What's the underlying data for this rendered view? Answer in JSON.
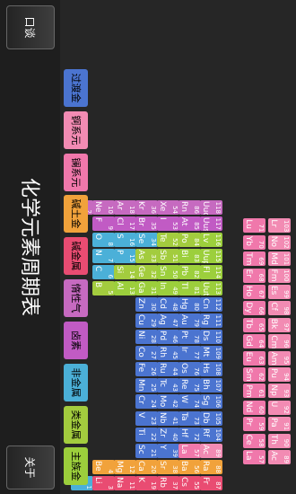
{
  "title": "化学元素周期表",
  "buttons": {
    "about": "关于",
    "back": "口谈"
  },
  "legend": [
    {
      "label": "主族金属",
      "color": "#9ccf3c"
    },
    {
      "label": "类金属",
      "color": "#a3cc3e"
    },
    {
      "label": "非金属",
      "color": "#4bb0d8"
    },
    {
      "label": "卤素",
      "color": "#c15bc4"
    },
    {
      "label": "惰性气体",
      "color": "#c66ac0"
    },
    {
      "label": "碱金属",
      "color": "#e94c72"
    },
    {
      "label": "碱土金属",
      "color": "#f1a23b"
    },
    {
      "label": "镧系元素",
      "color": "#f078ab"
    },
    {
      "label": "锕系元素",
      "color": "#f28bb3"
    },
    {
      "label": "过渡金属",
      "color": "#4b74d0"
    }
  ],
  "elements": [
    {
      "n": "1",
      "s": "H",
      "c": "#4bb0d8"
    },
    {
      "n": "2",
      "s": "He",
      "c": "#c66ac0"
    },
    {
      "n": "3",
      "s": "Li",
      "c": "#e94c72"
    },
    {
      "n": "4",
      "s": "Be",
      "c": "#f1a23b"
    },
    {
      "n": "5",
      "s": "B",
      "c": "#a3cc3e"
    },
    {
      "n": "6",
      "s": "C",
      "c": "#4bb0d8"
    },
    {
      "n": "7",
      "s": "N",
      "c": "#4bb0d8"
    },
    {
      "n": "8",
      "s": "O",
      "c": "#4bb0d8"
    },
    {
      "n": "9",
      "s": "F",
      "c": "#c15bc4"
    },
    {
      "n": "10",
      "s": "Ne",
      "c": "#c66ac0"
    },
    {
      "n": "11",
      "s": "Na",
      "c": "#e94c72"
    },
    {
      "n": "12",
      "s": "Mg",
      "c": "#f1a23b"
    },
    {
      "n": "13",
      "s": "Al",
      "c": "#9ccf3c"
    },
    {
      "n": "14",
      "s": "Si",
      "c": "#a3cc3e"
    },
    {
      "n": "15",
      "s": "P",
      "c": "#4bb0d8"
    },
    {
      "n": "16",
      "s": "S",
      "c": "#4bb0d8"
    },
    {
      "n": "17",
      "s": "Cl",
      "c": "#c15bc4"
    },
    {
      "n": "18",
      "s": "Ar",
      "c": "#c66ac0"
    },
    {
      "n": "19",
      "s": "K",
      "c": "#e94c72"
    },
    {
      "n": "20",
      "s": "Ca",
      "c": "#f1a23b"
    },
    {
      "n": "21",
      "s": "Sc",
      "c": "#4b74d0"
    },
    {
      "n": "22",
      "s": "Ti",
      "c": "#4b74d0"
    },
    {
      "n": "23",
      "s": "V",
      "c": "#4b74d0"
    },
    {
      "n": "24",
      "s": "Cr",
      "c": "#4b74d0"
    },
    {
      "n": "25",
      "s": "Mn",
      "c": "#4b74d0"
    },
    {
      "n": "26",
      "s": "Fe",
      "c": "#4b74d0"
    },
    {
      "n": "27",
      "s": "Co",
      "c": "#4b74d0"
    },
    {
      "n": "28",
      "s": "Ni",
      "c": "#4b74d0"
    },
    {
      "n": "29",
      "s": "Cu",
      "c": "#4b74d0"
    },
    {
      "n": "30",
      "s": "Zn",
      "c": "#4b74d0"
    },
    {
      "n": "31",
      "s": "Ga",
      "c": "#9ccf3c"
    },
    {
      "n": "32",
      "s": "Ge",
      "c": "#a3cc3e"
    },
    {
      "n": "33",
      "s": "As",
      "c": "#a3cc3e"
    },
    {
      "n": "34",
      "s": "Se",
      "c": "#4bb0d8"
    },
    {
      "n": "35",
      "s": "Br",
      "c": "#c15bc4"
    },
    {
      "n": "36",
      "s": "Kr",
      "c": "#c66ac0"
    },
    {
      "n": "37",
      "s": "Rb",
      "c": "#e94c72"
    },
    {
      "n": "38",
      "s": "Sr",
      "c": "#f1a23b"
    },
    {
      "n": "39",
      "s": "Y",
      "c": "#4b74d0"
    },
    {
      "n": "40",
      "s": "Zr",
      "c": "#4b74d0"
    },
    {
      "n": "41",
      "s": "Nb",
      "c": "#4b74d0"
    },
    {
      "n": "42",
      "s": "Mo",
      "c": "#4b74d0"
    },
    {
      "n": "43",
      "s": "Tc",
      "c": "#4b74d0"
    },
    {
      "n": "44",
      "s": "Ru",
      "c": "#4b74d0"
    },
    {
      "n": "45",
      "s": "Rh",
      "c": "#4b74d0"
    },
    {
      "n": "46",
      "s": "Pd",
      "c": "#4b74d0"
    },
    {
      "n": "47",
      "s": "Ag",
      "c": "#4b74d0"
    },
    {
      "n": "48",
      "s": "Cd",
      "c": "#4b74d0"
    },
    {
      "n": "49",
      "s": "In",
      "c": "#9ccf3c"
    },
    {
      "n": "50",
      "s": "Sn",
      "c": "#9ccf3c"
    },
    {
      "n": "51",
      "s": "Sb",
      "c": "#a3cc3e"
    },
    {
      "n": "52",
      "s": "Te",
      "c": "#a3cc3e"
    },
    {
      "n": "53",
      "s": "I",
      "c": "#c15bc4"
    },
    {
      "n": "54",
      "s": "Xe",
      "c": "#c66ac0"
    },
    {
      "n": "55",
      "s": "Cs",
      "c": "#e94c72"
    },
    {
      "n": "56",
      "s": "Ba",
      "c": "#f1a23b"
    },
    {
      "n": "57",
      "s": "La",
      "c": "#f078ab"
    },
    {
      "n": "72",
      "s": "Hf",
      "c": "#4b74d0"
    },
    {
      "n": "73",
      "s": "Ta",
      "c": "#4b74d0"
    },
    {
      "n": "74",
      "s": "W",
      "c": "#4b74d0"
    },
    {
      "n": "75",
      "s": "Re",
      "c": "#4b74d0"
    },
    {
      "n": "76",
      "s": "Os",
      "c": "#4b74d0"
    },
    {
      "n": "77",
      "s": "Ir",
      "c": "#4b74d0"
    },
    {
      "n": "78",
      "s": "Pt",
      "c": "#4b74d0"
    },
    {
      "n": "79",
      "s": "Au",
      "c": "#4b74d0"
    },
    {
      "n": "80",
      "s": "Hg",
      "c": "#4b74d0"
    },
    {
      "n": "81",
      "s": "Tl",
      "c": "#9ccf3c"
    },
    {
      "n": "82",
      "s": "Pb",
      "c": "#9ccf3c"
    },
    {
      "n": "83",
      "s": "Bi",
      "c": "#9ccf3c"
    },
    {
      "n": "84",
      "s": "Po",
      "c": "#a3cc3e"
    },
    {
      "n": "85",
      "s": "At",
      "c": "#c15bc4"
    },
    {
      "n": "86",
      "s": "Rn",
      "c": "#c66ac0"
    },
    {
      "n": "87",
      "s": "Fr",
      "c": "#e94c72"
    },
    {
      "n": "88",
      "s": "Ra",
      "c": "#f1a23b"
    },
    {
      "n": "89",
      "s": "Ac",
      "c": "#f28bb3"
    },
    {
      "n": "104",
      "s": "Rf",
      "c": "#4b74d0"
    },
    {
      "n": "105",
      "s": "Db",
      "c": "#4b74d0"
    },
    {
      "n": "106",
      "s": "Sg",
      "c": "#4b74d0"
    },
    {
      "n": "107",
      "s": "Bh",
      "c": "#4b74d0"
    },
    {
      "n": "108",
      "s": "Hs",
      "c": "#4b74d0"
    },
    {
      "n": "109",
      "s": "Mt",
      "c": "#4b74d0"
    },
    {
      "n": "110",
      "s": "Ds",
      "c": "#4b74d0"
    },
    {
      "n": "111",
      "s": "Rg",
      "c": "#4b74d0"
    },
    {
      "n": "112",
      "s": "Cn",
      "c": "#4b74d0"
    },
    {
      "n": "113",
      "s": "Uut",
      "c": "#9ccf3c"
    },
    {
      "n": "114",
      "s": "Fl",
      "c": "#9ccf3c"
    },
    {
      "n": "115",
      "s": "Uup",
      "c": "#9ccf3c"
    },
    {
      "n": "116",
      "s": "Lv",
      "c": "#9ccf3c"
    },
    {
      "n": "117",
      "s": "Uus",
      "c": "#c15bc4"
    },
    {
      "n": "118",
      "s": "Uuo",
      "c": "#c66ac0"
    },
    {
      "n": "57",
      "s": "La",
      "c": "#f078ab"
    },
    {
      "n": "58",
      "s": "Ce",
      "c": "#f078ab"
    },
    {
      "n": "59",
      "s": "Pr",
      "c": "#f078ab"
    },
    {
      "n": "60",
      "s": "Nd",
      "c": "#f078ab"
    },
    {
      "n": "61",
      "s": "Pm",
      "c": "#f078ab"
    },
    {
      "n": "62",
      "s": "Sm",
      "c": "#f078ab"
    },
    {
      "n": "63",
      "s": "Eu",
      "c": "#f078ab"
    },
    {
      "n": "64",
      "s": "Gd",
      "c": "#f078ab"
    },
    {
      "n": "65",
      "s": "Tb",
      "c": "#f078ab"
    },
    {
      "n": "66",
      "s": "Dy",
      "c": "#f078ab"
    },
    {
      "n": "67",
      "s": "Ho",
      "c": "#f078ab"
    },
    {
      "n": "68",
      "s": "Er",
      "c": "#f078ab"
    },
    {
      "n": "69",
      "s": "Tm",
      "c": "#f078ab"
    },
    {
      "n": "70",
      "s": "Yb",
      "c": "#f078ab"
    },
    {
      "n": "71",
      "s": "Lu",
      "c": "#f078ab"
    },
    {
      "n": "89",
      "s": "Ac",
      "c": "#f28bb3"
    },
    {
      "n": "90",
      "s": "Th",
      "c": "#f28bb3"
    },
    {
      "n": "91",
      "s": "Pa",
      "c": "#f28bb3"
    },
    {
      "n": "92",
      "s": "U",
      "c": "#f28bb3"
    },
    {
      "n": "93",
      "s": "Np",
      "c": "#f28bb3"
    },
    {
      "n": "94",
      "s": "Pu",
      "c": "#f28bb3"
    },
    {
      "n": "95",
      "s": "Am",
      "c": "#f28bb3"
    },
    {
      "n": "96",
      "s": "Cm",
      "c": "#f28bb3"
    },
    {
      "n": "97",
      "s": "Bk",
      "c": "#f28bb3"
    },
    {
      "n": "98",
      "s": "Cf",
      "c": "#f28bb3"
    },
    {
      "n": "99",
      "s": "Es",
      "c": "#f28bb3"
    },
    {
      "n": "100",
      "s": "Fm",
      "c": "#f28bb3"
    },
    {
      "n": "101",
      "s": "Md",
      "c": "#f28bb3"
    },
    {
      "n": "102",
      "s": "No",
      "c": "#f28bb3"
    },
    {
      "n": "103",
      "s": "Lr",
      "c": "#f28bb3"
    }
  ]
}
